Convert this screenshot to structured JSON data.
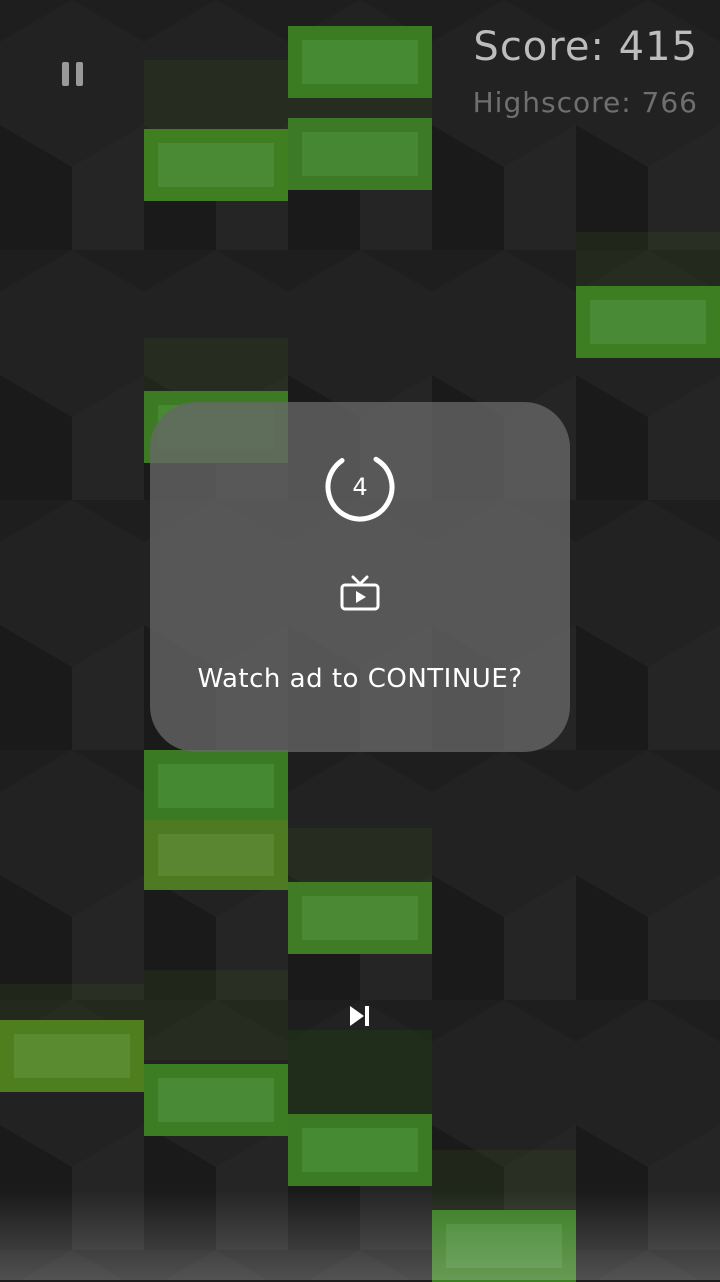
{
  "hud": {
    "score_text": "Score: 415",
    "highscore_text": "Highscore: 766"
  },
  "dialog": {
    "countdown": "4",
    "message": "Watch ad to CONTINUE?"
  },
  "icons": {
    "pause": "pause-icon",
    "tv": "tv-play-icon",
    "skip": "skip-next-icon"
  },
  "colors": {
    "background": "#1d1d1d",
    "tile_green": "#3c7d22",
    "tile_green_inner": "#4a8a34",
    "tile_lime": "#5a8a22",
    "tile_lime_inner": "#6a9a36",
    "dialog_bg": "#666666",
    "text_white": "#ffffff"
  }
}
